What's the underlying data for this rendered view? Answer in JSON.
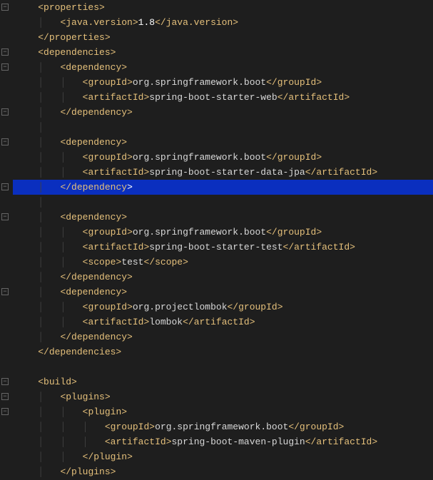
{
  "colors": {
    "bg": "#1e1e1e",
    "tag": "#e5c07b",
    "highlight": "#0a2fbf"
  },
  "lines": [
    {
      "indent": 1,
      "tokens": [
        {
          "t": "tag",
          "v": "<properties>"
        }
      ],
      "fold": true
    },
    {
      "indent": 2,
      "tokens": [
        {
          "t": "tag",
          "v": "<java.version>"
        },
        {
          "t": "white",
          "v": "1.8"
        },
        {
          "t": "tag",
          "v": "</java.version>"
        }
      ]
    },
    {
      "indent": 1,
      "tokens": [
        {
          "t": "tag",
          "v": "</properties>"
        }
      ]
    },
    {
      "indent": 1,
      "tokens": [
        {
          "t": "tag",
          "v": "<dependencies>"
        }
      ],
      "fold": true
    },
    {
      "indent": 2,
      "tokens": [
        {
          "t": "tag",
          "v": "<dependency>"
        }
      ],
      "fold": true
    },
    {
      "indent": 3,
      "tokens": [
        {
          "t": "tag",
          "v": "<groupId>"
        },
        {
          "t": "val",
          "v": "org.springframework.boot"
        },
        {
          "t": "tag",
          "v": "</groupId>"
        }
      ]
    },
    {
      "indent": 3,
      "tokens": [
        {
          "t": "tag",
          "v": "<artifactId>"
        },
        {
          "t": "val",
          "v": "spring-boot-starter-web"
        },
        {
          "t": "tag",
          "v": "</artifactId>"
        }
      ]
    },
    {
      "indent": 2,
      "tokens": [
        {
          "t": "tag",
          "v": "</dependency>"
        }
      ],
      "fold": true
    },
    {
      "indent": 2,
      "tokens": [],
      "blank": true
    },
    {
      "indent": 2,
      "tokens": [
        {
          "t": "tag",
          "v": "<dependency>"
        }
      ],
      "fold": true
    },
    {
      "indent": 3,
      "tokens": [
        {
          "t": "tag",
          "v": "<groupId>"
        },
        {
          "t": "val",
          "v": "org.springframework.boot"
        },
        {
          "t": "tag",
          "v": "</groupId>"
        }
      ]
    },
    {
      "indent": 3,
      "tokens": [
        {
          "t": "tag",
          "v": "<artifactId>"
        },
        {
          "t": "val",
          "v": "spring-boot-starter-data-jpa"
        },
        {
          "t": "tag",
          "v": "</artifactId>"
        }
      ]
    },
    {
      "indent": 2,
      "tokens": [
        {
          "t": "tag",
          "v": "</dependency"
        },
        {
          "t": "white",
          "v": ">"
        }
      ],
      "highlight": true,
      "fold": true
    },
    {
      "indent": 2,
      "tokens": [],
      "blank": true
    },
    {
      "indent": 2,
      "tokens": [
        {
          "t": "tag",
          "v": "<dependency>"
        }
      ],
      "fold": true
    },
    {
      "indent": 3,
      "tokens": [
        {
          "t": "tag",
          "v": "<groupId>"
        },
        {
          "t": "val",
          "v": "org.springframework.boot"
        },
        {
          "t": "tag",
          "v": "</groupId>"
        }
      ]
    },
    {
      "indent": 3,
      "tokens": [
        {
          "t": "tag",
          "v": "<artifactId>"
        },
        {
          "t": "val",
          "v": "spring-boot-starter-test"
        },
        {
          "t": "tag",
          "v": "</artifactId>"
        }
      ]
    },
    {
      "indent": 3,
      "tokens": [
        {
          "t": "tag",
          "v": "<scope>"
        },
        {
          "t": "val",
          "v": "test"
        },
        {
          "t": "tag",
          "v": "</scope>"
        }
      ]
    },
    {
      "indent": 2,
      "tokens": [
        {
          "t": "tag",
          "v": "</dependency>"
        }
      ]
    },
    {
      "indent": 2,
      "tokens": [
        {
          "t": "tag",
          "v": "<dependency>"
        }
      ],
      "fold": true
    },
    {
      "indent": 3,
      "tokens": [
        {
          "t": "tag",
          "v": "<groupId>"
        },
        {
          "t": "val",
          "v": "org.projectlombok"
        },
        {
          "t": "tag",
          "v": "</groupId>"
        }
      ]
    },
    {
      "indent": 3,
      "tokens": [
        {
          "t": "tag",
          "v": "<artifactId>"
        },
        {
          "t": "val",
          "v": "lombok"
        },
        {
          "t": "tag",
          "v": "</artifactId>"
        }
      ]
    },
    {
      "indent": 2,
      "tokens": [
        {
          "t": "tag",
          "v": "</dependency>"
        }
      ]
    },
    {
      "indent": 1,
      "tokens": [
        {
          "t": "tag",
          "v": "</dependencies>"
        }
      ]
    },
    {
      "indent": 1,
      "tokens": [],
      "blank": true
    },
    {
      "indent": 1,
      "tokens": [
        {
          "t": "tag",
          "v": "<build>"
        }
      ],
      "fold": true
    },
    {
      "indent": 2,
      "tokens": [
        {
          "t": "tag",
          "v": "<plugins>"
        }
      ],
      "fold": true
    },
    {
      "indent": 3,
      "tokens": [
        {
          "t": "tag",
          "v": "<plugin>"
        }
      ],
      "fold": true
    },
    {
      "indent": 4,
      "tokens": [
        {
          "t": "tag",
          "v": "<groupId>"
        },
        {
          "t": "val",
          "v": "org.springframework.boot"
        },
        {
          "t": "tag",
          "v": "</groupId>"
        }
      ]
    },
    {
      "indent": 4,
      "tokens": [
        {
          "t": "tag",
          "v": "<artifactId>"
        },
        {
          "t": "val",
          "v": "spring-boot-maven-plugin"
        },
        {
          "t": "tag",
          "v": "</artifactId>"
        }
      ]
    },
    {
      "indent": 3,
      "tokens": [
        {
          "t": "tag",
          "v": "</plugin>"
        }
      ]
    },
    {
      "indent": 2,
      "tokens": [
        {
          "t": "tag",
          "v": "</plugins>"
        }
      ]
    }
  ]
}
